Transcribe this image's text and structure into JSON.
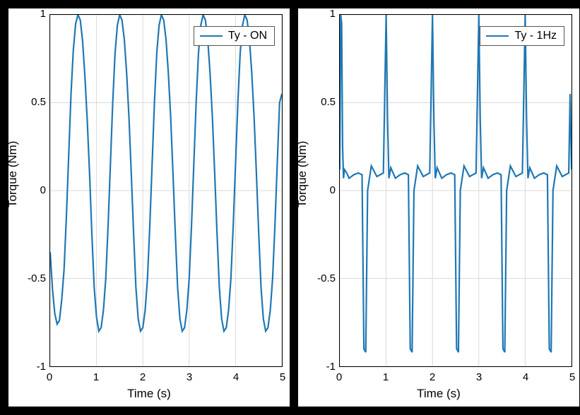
{
  "chart_data": [
    {
      "type": "line",
      "title": "",
      "xlabel": "Time (s)",
      "ylabel": "Torque (Nm)",
      "xlim": [
        0,
        5
      ],
      "ylim": [
        -1,
        1
      ],
      "xticks": [
        0,
        1,
        2,
        3,
        4,
        5
      ],
      "yticks": [
        -1,
        -0.5,
        0,
        0.5,
        1
      ],
      "legend_position": "top-right",
      "series": [
        {
          "name": "Ty - ON",
          "color": "#1f77b4",
          "x": [
            0,
            0.05,
            0.1,
            0.15,
            0.2,
            0.25,
            0.3,
            0.35,
            0.4,
            0.45,
            0.5,
            0.55,
            0.6,
            0.65,
            0.7,
            0.75,
            0.8,
            0.85,
            0.9,
            0.95,
            1,
            1.05,
            1.1,
            1.15,
            1.2,
            1.25,
            1.3,
            1.35,
            1.4,
            1.45,
            1.5,
            1.55,
            1.6,
            1.65,
            1.7,
            1.75,
            1.8,
            1.85,
            1.9,
            1.95,
            2,
            2.05,
            2.1,
            2.15,
            2.2,
            2.25,
            2.3,
            2.35,
            2.4,
            2.45,
            2.5,
            2.55,
            2.6,
            2.65,
            2.7,
            2.75,
            2.8,
            2.85,
            2.9,
            2.95,
            3,
            3.05,
            3.1,
            3.15,
            3.2,
            3.25,
            3.3,
            3.35,
            3.4,
            3.45,
            3.5,
            3.55,
            3.6,
            3.65,
            3.7,
            3.75,
            3.8,
            3.85,
            3.9,
            3.95,
            4,
            4.05,
            4.1,
            4.15,
            4.2,
            4.25,
            4.3,
            4.35,
            4.4,
            4.45,
            4.5,
            4.55,
            4.6,
            4.65,
            4.7,
            4.75,
            4.8,
            4.85,
            4.9,
            4.95,
            5
          ],
          "y": [
            -0.35,
            -0.56,
            -0.7,
            -0.76,
            -0.74,
            -0.62,
            -0.45,
            -0.15,
            0.2,
            0.55,
            0.8,
            0.95,
            1.0,
            0.97,
            0.85,
            0.65,
            0.4,
            0.1,
            -0.25,
            -0.55,
            -0.72,
            -0.8,
            -0.78,
            -0.68,
            -0.5,
            -0.2,
            0.15,
            0.5,
            0.78,
            0.94,
            1.0,
            0.97,
            0.86,
            0.67,
            0.42,
            0.1,
            -0.24,
            -0.55,
            -0.73,
            -0.8,
            -0.78,
            -0.68,
            -0.5,
            -0.2,
            0.15,
            0.5,
            0.78,
            0.94,
            1.0,
            0.97,
            0.86,
            0.67,
            0.42,
            0.1,
            -0.24,
            -0.55,
            -0.73,
            -0.8,
            -0.78,
            -0.68,
            -0.5,
            -0.2,
            0.15,
            0.5,
            0.78,
            0.94,
            1.0,
            0.97,
            0.86,
            0.67,
            0.42,
            0.1,
            -0.24,
            -0.55,
            -0.73,
            -0.8,
            -0.78,
            -0.68,
            -0.5,
            -0.2,
            0.15,
            0.5,
            0.78,
            0.94,
            1.0,
            0.97,
            0.86,
            0.67,
            0.42,
            0.1,
            -0.24,
            -0.55,
            -0.73,
            -0.8,
            -0.78,
            -0.68,
            -0.5,
            -0.2,
            0.15,
            0.5,
            0.55
          ]
        }
      ]
    },
    {
      "type": "line",
      "title": "",
      "xlabel": "Time (s)",
      "ylabel": "Torque (Nm)",
      "xlim": [
        0,
        5
      ],
      "ylim": [
        -1,
        1
      ],
      "xticks": [
        0,
        1,
        2,
        3,
        4,
        5
      ],
      "yticks": [
        -1,
        -0.5,
        0,
        0.5,
        1
      ],
      "legend_position": "top-right",
      "series": [
        {
          "name": "Ty - 1Hz",
          "color": "#1f77b4",
          "x": [
            0,
            0.02,
            0.04,
            0.06,
            0.08,
            0.1,
            0.15,
            0.2,
            0.3,
            0.4,
            0.48,
            0.52,
            0.56,
            0.6,
            0.68,
            0.8,
            0.94,
            0.97,
            1.0,
            1.03,
            1.06,
            1.1,
            1.15,
            1.2,
            1.3,
            1.4,
            1.48,
            1.52,
            1.56,
            1.6,
            1.68,
            1.8,
            1.94,
            1.97,
            2.0,
            2.03,
            2.06,
            2.1,
            2.15,
            2.2,
            2.3,
            2.4,
            2.48,
            2.52,
            2.56,
            2.6,
            2.68,
            2.8,
            2.94,
            2.97,
            3.0,
            3.03,
            3.06,
            3.1,
            3.15,
            3.2,
            3.3,
            3.4,
            3.48,
            3.52,
            3.56,
            3.6,
            3.68,
            3.8,
            3.94,
            3.97,
            4.0,
            4.03,
            4.06,
            4.1,
            4.15,
            4.2,
            4.3,
            4.4,
            4.48,
            4.52,
            4.56,
            4.6,
            4.68,
            4.8,
            4.94,
            4.97,
            5.0
          ],
          "y": [
            0.12,
            1.0,
            0.95,
            0.25,
            0.07,
            0.12,
            0.1,
            0.07,
            0.09,
            0.1,
            0.09,
            -0.9,
            -0.92,
            0.0,
            0.14,
            0.08,
            0.1,
            0.55,
            1.0,
            0.4,
            0.07,
            0.13,
            0.1,
            0.07,
            0.09,
            0.1,
            0.09,
            -0.9,
            -0.92,
            0.0,
            0.14,
            0.08,
            0.1,
            0.55,
            1.0,
            0.4,
            0.07,
            0.13,
            0.1,
            0.07,
            0.09,
            0.1,
            0.09,
            -0.9,
            -0.92,
            0.0,
            0.14,
            0.08,
            0.1,
            0.55,
            1.0,
            0.4,
            0.07,
            0.13,
            0.1,
            0.07,
            0.09,
            0.1,
            0.09,
            -0.9,
            -0.92,
            0.0,
            0.14,
            0.08,
            0.1,
            0.55,
            1.0,
            0.4,
            0.07,
            0.13,
            0.1,
            0.07,
            0.09,
            0.1,
            0.09,
            -0.9,
            -0.92,
            0.0,
            0.14,
            0.08,
            0.1,
            0.55,
            0.12
          ]
        }
      ]
    }
  ]
}
